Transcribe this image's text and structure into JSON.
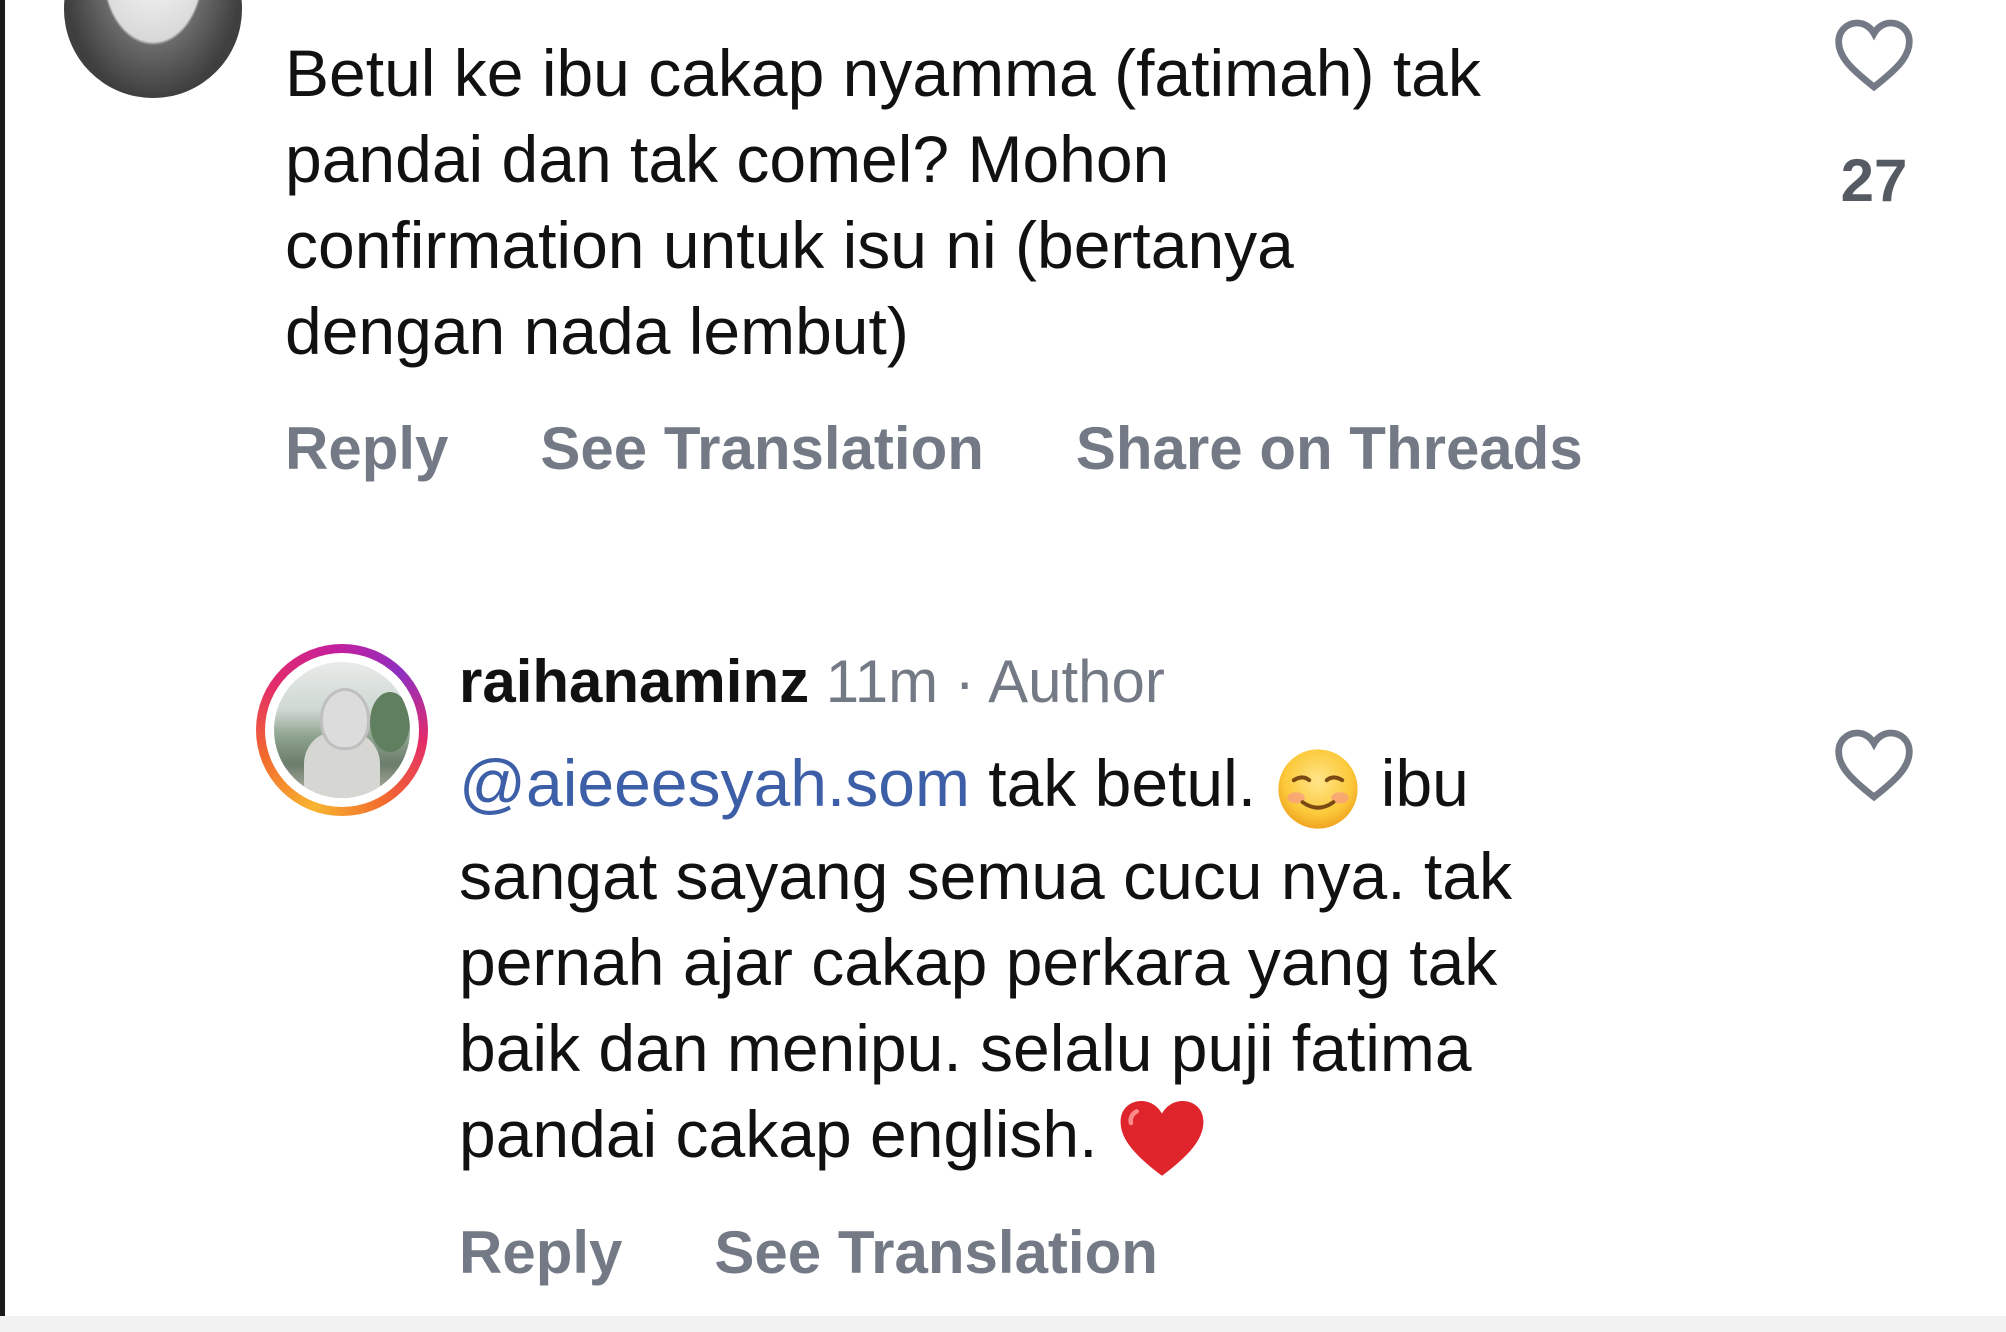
{
  "comment1": {
    "text": "Betul ke ibu cakap nyamma (fatimah) tak\npandai dan tak comel? Mohon\nconfirmation untuk isu ni (bertanya\ndengan nada lembut)",
    "like_count": "27",
    "actions": {
      "reply": "Reply",
      "see_translation": "See Translation",
      "share_threads": "Share on Threads"
    }
  },
  "comment2": {
    "username": "raihanaminz",
    "time": "11m",
    "separator": "·",
    "role": "Author",
    "mention": "@aieeesyah.som",
    "text_part1": " tak betul. ",
    "emoji1": "smiling-face-emoji",
    "text_part2": " ibu\nsangat sayang semua cucu nya. tak\npernah ajar cakap perkara yang tak\nbaik dan menipu. selalu puji fatima\npandai cakap english. ",
    "emoji2": "red-heart-emoji",
    "actions": {
      "reply": "Reply",
      "see_translation": "See Translation"
    }
  },
  "colors": {
    "mention": "#3c5fa8",
    "action_text": "#737985",
    "story_ring_start": "#f8b52f",
    "story_ring_end": "#c51f9d"
  }
}
